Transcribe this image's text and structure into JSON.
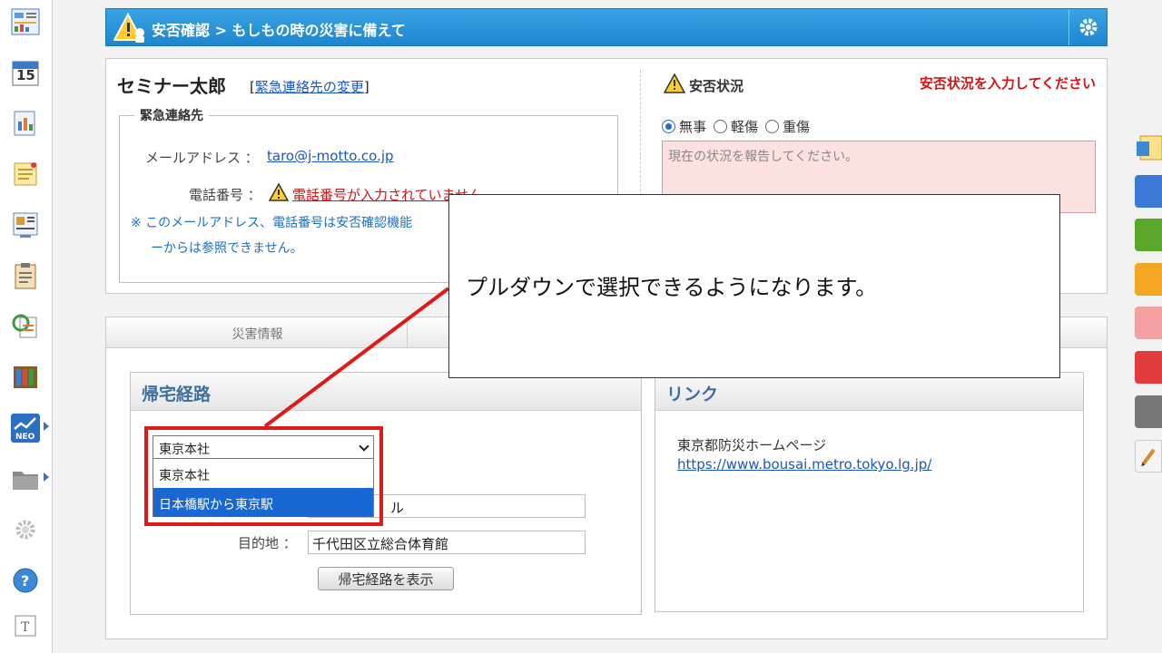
{
  "header": {
    "breadcrumb": "安否確認 > もしもの時の災害に備えて"
  },
  "user": {
    "name": "セミナー太郎",
    "change_link_prefix": "[",
    "change_link": "緊急連絡先の変更",
    "change_link_suffix": "]"
  },
  "emergency": {
    "legend": "緊急連絡先",
    "email_label": "メールアドレス ：",
    "email_value": "taro@j-motto.co.jp",
    "phone_label": "電話番号 ：",
    "phone_value": "電話番号が入力されていません",
    "note_line1": "※ このメールアドレス、電話番号は安否確認機能",
    "note_line2": "ーからは参照できません。"
  },
  "safety": {
    "title": "安否状況",
    "warning": "安否状況を入力してください",
    "options": [
      "無事",
      "軽傷",
      "重傷"
    ],
    "selected": "無事",
    "report_placeholder": "現在の状況を報告してください。"
  },
  "tabs": {
    "disaster_info": "災害情報"
  },
  "route": {
    "title": "帰宅経路",
    "select_value": "東京本社",
    "options": [
      "東京本社",
      "日本橋駅から東京駅"
    ],
    "origin_suffix": "ル",
    "destination_label": "目的地 ：",
    "destination_value": "千代田区立総合体育館",
    "show_button": "帰宅経路を表示"
  },
  "links": {
    "title": "リンク",
    "item_label": "東京都防災ホームページ",
    "item_url": "https://www.bousai.metro.tokyo.lg.jp/"
  },
  "callout": {
    "text": "プルダウンで選択できるようになります。"
  },
  "colors": {
    "header_blue": "#1d86cf",
    "warning_red": "#d41414",
    "highlight_red": "#e01919",
    "selected_option": "#1967d2",
    "link_blue": "#1a56c4"
  },
  "sidebar": {
    "calendar_day": "15",
    "icons": [
      "dashboard-icon",
      "calendar-icon",
      "report-icon",
      "memo-icon",
      "board-icon",
      "clipboard-icon",
      "refresh-doc-icon",
      "binder-icon",
      "neo-icon",
      "folder-icon",
      "settings-icon",
      "help-icon",
      "text-icon"
    ]
  }
}
